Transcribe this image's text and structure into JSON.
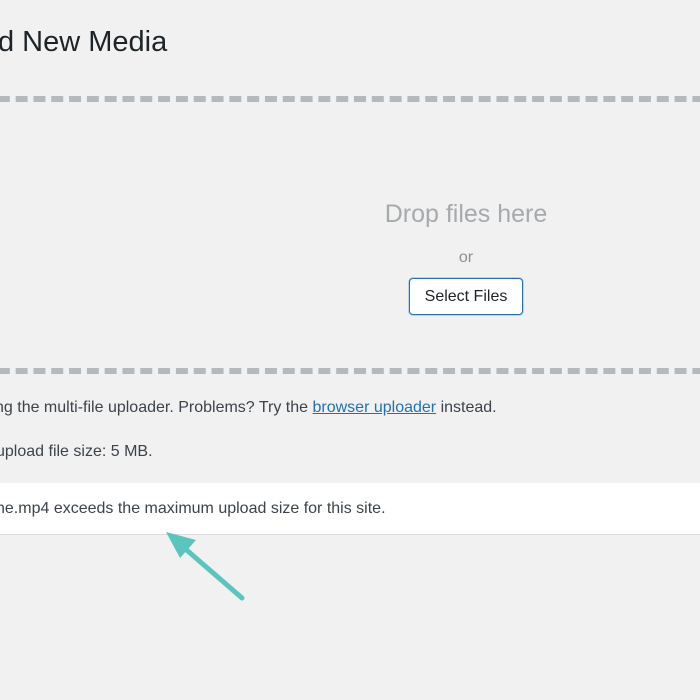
{
  "header": {
    "title": "d New Media"
  },
  "dropzone": {
    "drop_text": "Drop files here",
    "or_text": "or",
    "select_button": "Select Files"
  },
  "uploader": {
    "note_prefix": "ng the multi-file uploader. Problems? Try the ",
    "link_text": "browser uploader",
    "note_suffix": " instead.",
    "max_size_text": "upload file size: 5 MB."
  },
  "error": {
    "message": "ne.mp4 exceeds the maximum upload size for this site."
  },
  "colors": {
    "background": "#f1f1f1",
    "dash_border": "#b4b9be",
    "link": "#2271b1",
    "button_border": "#2271b1",
    "arrow": "#5bc4bf"
  },
  "annotation": {
    "icon": "arrow-pointer-icon"
  }
}
